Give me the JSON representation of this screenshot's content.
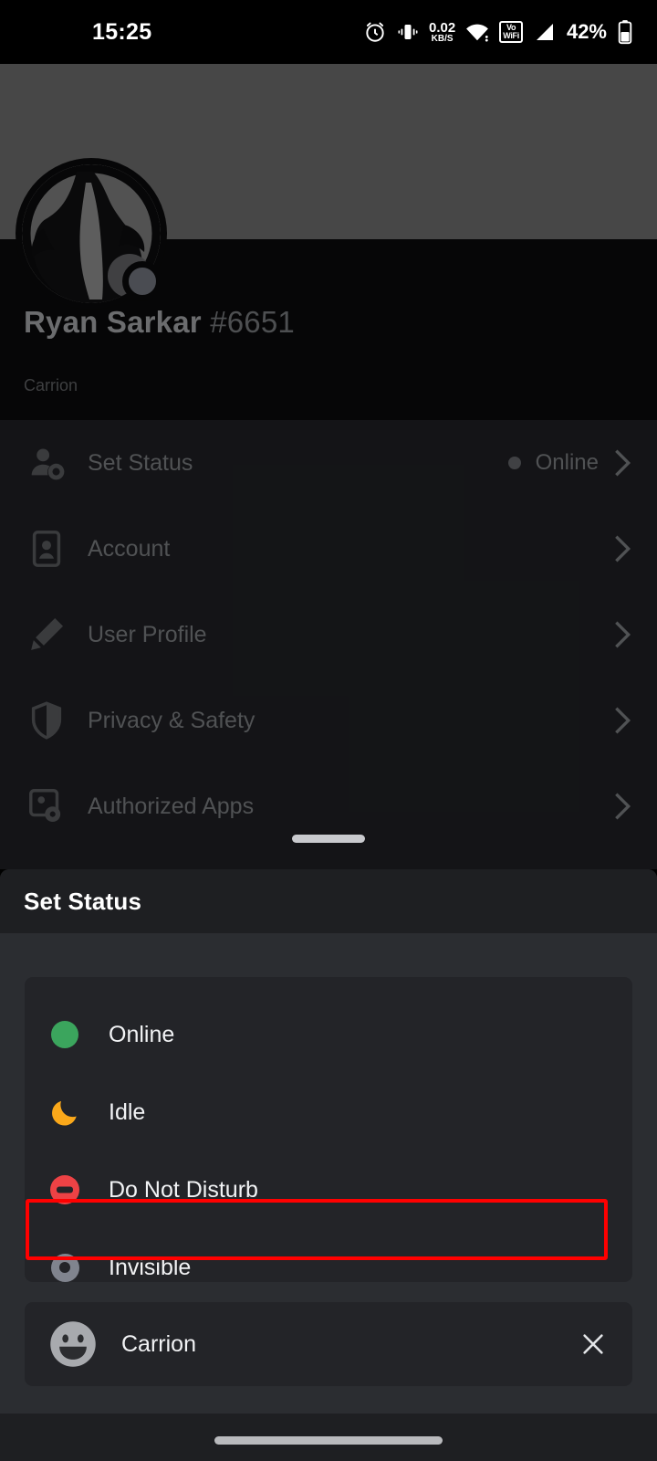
{
  "status_bar": {
    "time": "15:25",
    "network_speed_value": "0.02",
    "network_speed_unit": "KB/S",
    "vowifi_line1": "Vo",
    "vowifi_line2": "WiFi",
    "battery_percent": "42%",
    "icons": [
      "alarm-icon",
      "vibrate-icon",
      "wifi-icon",
      "vowifi-icon",
      "cellular-signal-icon",
      "battery-icon"
    ]
  },
  "profile": {
    "username": "Ryan Sarkar",
    "discriminator": "#6651",
    "custom_status": "Carrion",
    "banner_color": "#7a7a7a",
    "presence_indicator_color": "#80848e"
  },
  "settings": {
    "items": [
      {
        "label": "Set Status",
        "icon": "person-status-icon",
        "value": "Online",
        "has_chevron": true,
        "has_dot": true
      },
      {
        "label": "Account",
        "icon": "account-card-icon",
        "value": "",
        "has_chevron": true,
        "has_dot": false
      },
      {
        "label": "User Profile",
        "icon": "pencil-icon",
        "value": "",
        "has_chevron": true,
        "has_dot": false
      },
      {
        "label": "Privacy & Safety",
        "icon": "shield-icon",
        "value": "",
        "has_chevron": true,
        "has_dot": false
      },
      {
        "label": "Authorized Apps",
        "icon": "authorized-apps-icon",
        "value": "",
        "has_chevron": true,
        "has_dot": false
      }
    ]
  },
  "sheet": {
    "title": "Set Status",
    "options": [
      {
        "label": "Online",
        "icon": "green-dot-icon",
        "color": "#3ba55d",
        "selected": false
      },
      {
        "label": "Idle",
        "icon": "crescent-moon-icon",
        "color": "#faa81a",
        "selected": false
      },
      {
        "label": "Do Not Disturb",
        "icon": "dnd-icon",
        "color": "#ed4245",
        "selected": false
      },
      {
        "label": "Invisible",
        "icon": "invisible-ring-icon",
        "color": "#80848e",
        "selected": true
      }
    ],
    "custom_status": {
      "emoji": "smiley-icon",
      "text": "Carrion",
      "clear_icon": "close-icon"
    },
    "highlight_color": "#ff0000"
  },
  "colors": {
    "sheet_bg": "#2b2d31",
    "sheet_header_bg": "#1e1f22",
    "card_bg": "#232428",
    "page_bg": "#232428",
    "profile_bg": "#0c0c0d"
  }
}
